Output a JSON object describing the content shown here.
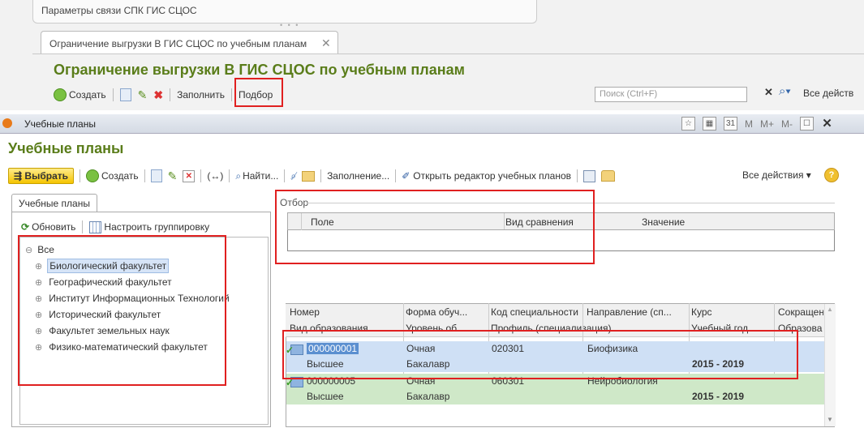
{
  "background_window": {
    "strip_label": "Параметры связи СПК ГИС СЦОС",
    "tab_label": "Ограничение выгрузки В ГИС СЦОС по учебным планам",
    "tab_close": "✕",
    "title": "Ограничение выгрузки В ГИС СЦОС по учебным планам",
    "toolbar": {
      "create": "Создать",
      "fill": "Заполнить",
      "pick": "Подбор"
    },
    "search_placeholder": "Поиск (Ctrl+F)",
    "all_actions": "Все действ"
  },
  "modal": {
    "window_title": "Учебные планы",
    "window_controls": [
      "M",
      "M+",
      "M-"
    ],
    "heading": "Учебные планы",
    "toolbar": {
      "select": "Выбрать",
      "create": "Создать",
      "find": "Найти...",
      "fill": "Заполнение...",
      "open_editor": "Открыть редактор учебных планов",
      "all_actions": "Все действия ▾",
      "help": "?"
    },
    "left_panel": {
      "tab": "Учебные планы",
      "refresh": "Обновить",
      "grouping": "Настроить группировку",
      "tree": {
        "root": "Все",
        "items": [
          "Биологический факультет",
          "Географический факультет",
          "Институт Информационных Технологий",
          "Исторический факультет",
          "Факультет земельных наук",
          "Физико-математический факультет"
        ]
      }
    },
    "filter": {
      "label": "Отбор",
      "columns": [
        "Поле",
        "Вид сравнения",
        "Значение"
      ]
    },
    "table": {
      "header1": [
        "Номер",
        "Форма обуч...",
        "Код специальности",
        "Направление (сп...",
        "Курс",
        "Сокращен"
      ],
      "header2": [
        "Вид образования",
        "Уровень об...",
        "Профиль (специализация)",
        "",
        "Учебный год",
        "Образова"
      ],
      "rows": [
        {
          "line1": [
            "000000001",
            "Очная",
            "020301",
            "Биофизика",
            "",
            ""
          ],
          "line2": [
            "Высшее",
            "Бакалавр",
            "",
            "",
            "2015 - 2019",
            ""
          ]
        },
        {
          "line1": [
            "000000005",
            "Очная",
            "060301",
            "Нейробиология",
            "",
            ""
          ],
          "line2": [
            "Высшее",
            "Бакалавр",
            "",
            "",
            "2015 - 2019",
            ""
          ]
        }
      ]
    }
  },
  "colors": {
    "title_green": "#5a7d1a",
    "highlight_red": "#e02020",
    "row_selected_blue": "#cfe0f5",
    "row_green": "#cfe8c8"
  }
}
